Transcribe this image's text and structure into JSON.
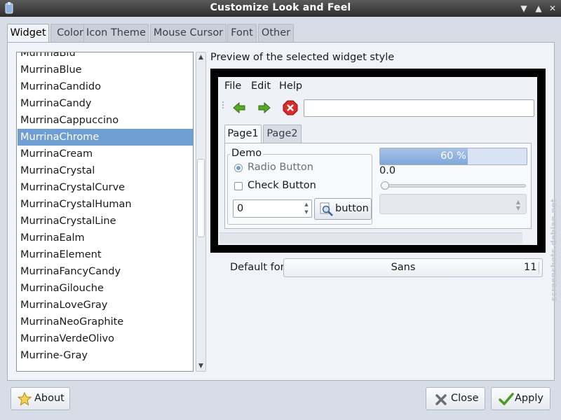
{
  "window": {
    "title": "Customize Look and Feel"
  },
  "tabs": [
    {
      "label": "Widget",
      "active": true
    },
    {
      "label": "Color"
    },
    {
      "label": "Icon Theme"
    },
    {
      "label": "Mouse Cursor"
    },
    {
      "label": "Font"
    },
    {
      "label": "Other"
    }
  ],
  "theme_list": {
    "selected": "MurrinaChrome",
    "items": [
      "MurrinaBlu",
      "MurrinaBlue",
      "MurrinaCandido",
      "MurrinaCandy",
      "MurrinaCappuccino",
      "MurrinaChrome",
      "MurrinaCream",
      "MurrinaCrystal",
      "MurrinaCrystalCurve",
      "MurrinaCrystalHuman",
      "MurrinaCrystalLine",
      "MurrinaEalm",
      "MurrinaElement",
      "MurrinaFancyCandy",
      "MurrinaGilouche",
      "MurrinaLoveGray",
      "MurrinaNeoGraphite",
      "MurrinaVerdeOlivo",
      "Murrine-Gray"
    ]
  },
  "preview": {
    "label": "Preview of the selected widget style",
    "menu": [
      "File",
      "Edit",
      "Help"
    ],
    "tabs": [
      "Page1",
      "Page2"
    ],
    "demo_title": "Demo",
    "radio_label": "Radio Button",
    "check_label": "Check Button",
    "spin_value": "0",
    "button_label": "button",
    "progress": {
      "fraction": 0.6,
      "label": "60 %"
    },
    "slider_value": "0.0"
  },
  "font": {
    "label": "Default font:",
    "name": "Sans",
    "size": "11"
  },
  "buttons": {
    "about": "About",
    "close": "Close",
    "apply": "Apply"
  },
  "watermark": "screenshots.debian.net"
}
